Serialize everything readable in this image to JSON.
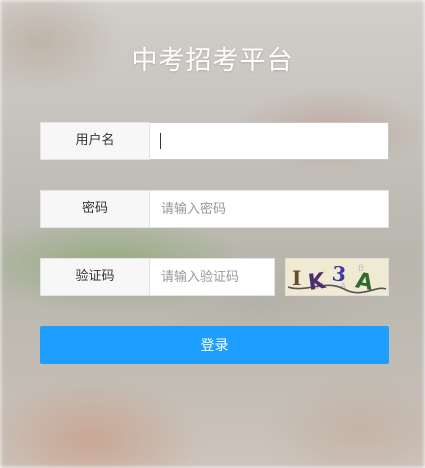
{
  "page": {
    "title": "中考招考平台"
  },
  "form": {
    "username": {
      "label": "用户名",
      "value": "",
      "placeholder": ""
    },
    "password": {
      "label": "密码",
      "value": "",
      "placeholder": "请输入密码"
    },
    "captcha": {
      "label": "验证码",
      "value": "",
      "placeholder": "请输入验证码",
      "image_text": "IK3A"
    },
    "submit_label": "登录"
  },
  "colors": {
    "primary": "#1e9fff",
    "title": "#ffffff"
  }
}
